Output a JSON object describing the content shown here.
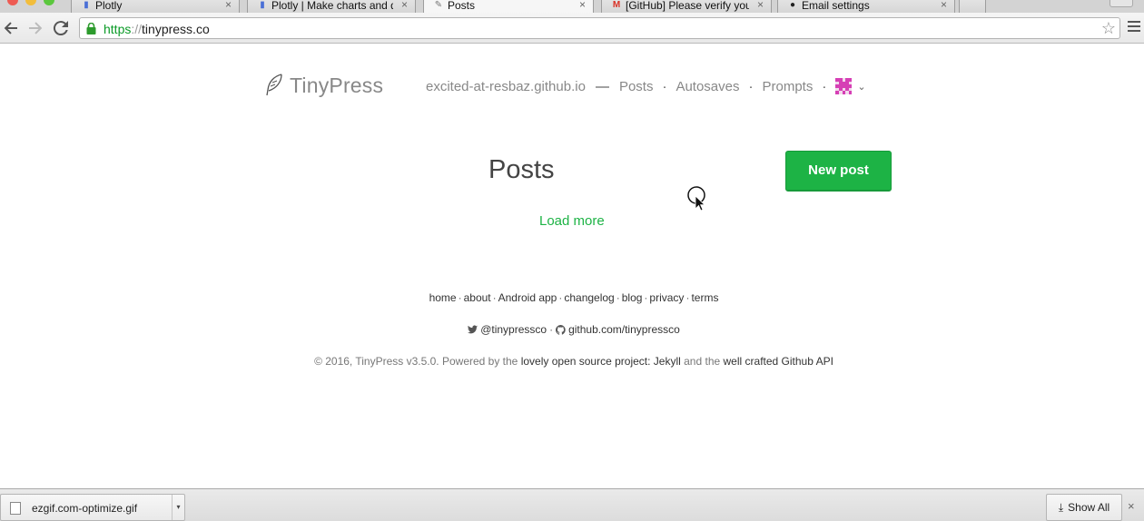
{
  "browser": {
    "tabs": [
      {
        "title": "Plotly",
        "icon": "plotly-icon",
        "active": false
      },
      {
        "title": "Plotly | Make charts and dashboards",
        "icon": "plotly-icon",
        "active": false
      },
      {
        "title": "Posts",
        "icon": "feather-icon",
        "active": true
      },
      {
        "title": "[GitHub] Please verify your email",
        "icon": "gmail-icon",
        "active": false
      },
      {
        "title": "Email settings",
        "icon": "github-icon",
        "active": false
      }
    ],
    "close_glyph": "×",
    "url_scheme": "https",
    "url_sep": "://",
    "url_host": "tinypress.co",
    "star_glyph": "☆"
  },
  "site": {
    "brand": "TinyPress",
    "nav": {
      "repo": "excited-at-resbaz.github.io",
      "dash": "—",
      "dot": "·",
      "posts": "Posts",
      "autosaves": "Autosaves",
      "prompts": "Prompts",
      "caret": "⌄"
    },
    "main": {
      "title": "Posts",
      "new_post": "New post",
      "load_more": "Load more"
    },
    "footer": {
      "links": [
        "home",
        "about",
        "Android app",
        "changelog",
        "blog",
        "privacy",
        "terms"
      ],
      "sep": "·",
      "twitter": "@tinypressco",
      "github": "github.com/tinypressco",
      "copy_prefix": "© 2016, TinyPress v3.5.0. Powered by the ",
      "copy_link1": "lovely open source project: Jekyll",
      "copy_mid": " and the ",
      "copy_link2": "well crafted Github API"
    }
  },
  "downloads": {
    "file": "ezgif.com-optimize.gif",
    "show_all": "Show All",
    "close": "×"
  },
  "colors": {
    "accent_green": "#1db345",
    "avatar_pink": "#d63fb5"
  }
}
